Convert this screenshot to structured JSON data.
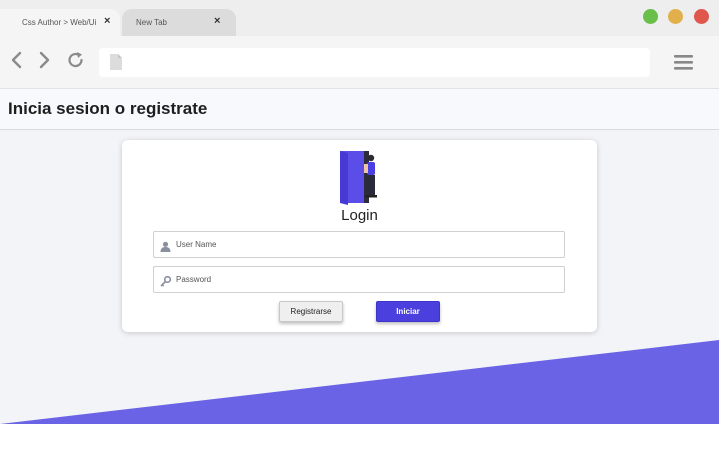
{
  "browser": {
    "tabs": [
      {
        "label": "Css Author > Web/Ui",
        "close": "×"
      },
      {
        "label": "New Tab",
        "close": "×"
      }
    ],
    "window_controls": {
      "green": "#6abf4b",
      "yellow": "#e2b04a",
      "red": "#e0574c"
    },
    "url": "",
    "icons": [
      "back-icon",
      "forward-icon",
      "reload-icon",
      "page-icon",
      "hamburger-menu-icon"
    ]
  },
  "app": {
    "header_title": "Inicia sesion o registrate",
    "accent_color": "#6b63e6"
  },
  "login_card": {
    "title": "Login",
    "username": {
      "placeholder": "User Name",
      "value": "",
      "icon": "user-icon"
    },
    "password": {
      "placeholder": "Password",
      "value": "",
      "icon": "key-icon"
    },
    "register_button": "Registrarse",
    "login_button": "Iniciar"
  }
}
